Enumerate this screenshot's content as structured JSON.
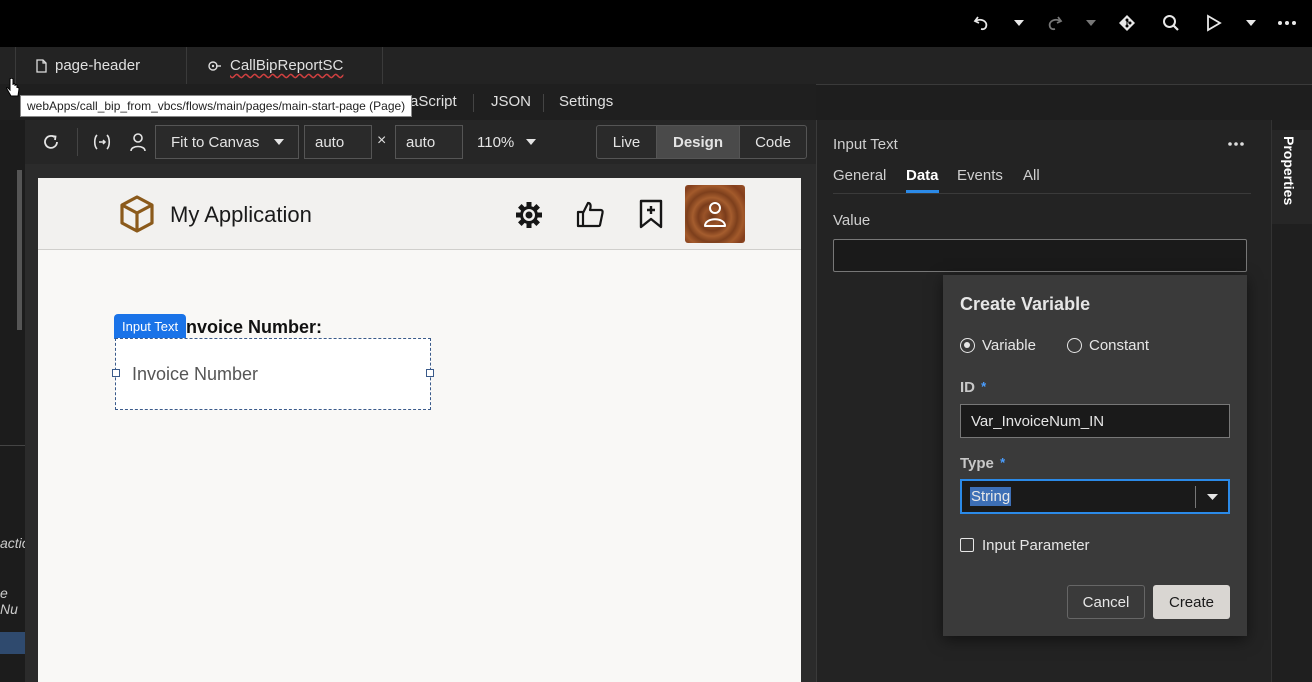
{
  "tabs": [
    {
      "label": "page-header",
      "icon": "file-icon"
    },
    {
      "label": "CallBipReportSC",
      "icon": "action-chain-icon"
    }
  ],
  "subtabs": {
    "visible_partial": "aScript",
    "json": "JSON",
    "settings": "Settings"
  },
  "tooltip": "webApps/call_bip_from_vbcs/flows/main/pages/main-start-page (Page)",
  "toolbar": {
    "fit": "Fit to Canvas",
    "width": "auto",
    "times": "×",
    "height": "auto",
    "zoom": "110%",
    "modes": [
      "Live",
      "Design",
      "Code"
    ],
    "active_mode": "Design"
  },
  "app": {
    "title": "My Application"
  },
  "canvas": {
    "badge": "Input Text",
    "label_partial": "nvoice Number:",
    "input_placeholder": "Invoice Number"
  },
  "left_partial": {
    "text1": "actio",
    "text2": "e Nu"
  },
  "props": {
    "title": "Input Text",
    "tabs": [
      "General",
      "Data",
      "Events",
      "All"
    ],
    "active_tab": "Data",
    "value_label": "Value",
    "side_label": "Properties"
  },
  "popup": {
    "title": "Create Variable",
    "radio_variable": "Variable",
    "radio_constant": "Constant",
    "id_label": "ID",
    "id_value": "Var_InvoiceNum_IN",
    "type_label": "Type",
    "type_value": "String",
    "required": "*",
    "input_param": "Input Parameter",
    "cancel": "Cancel",
    "create": "Create"
  },
  "colors": {
    "accent": "#1a73e8",
    "brand_cube": "#8b5a1b",
    "avatar": "#8e4b25"
  }
}
